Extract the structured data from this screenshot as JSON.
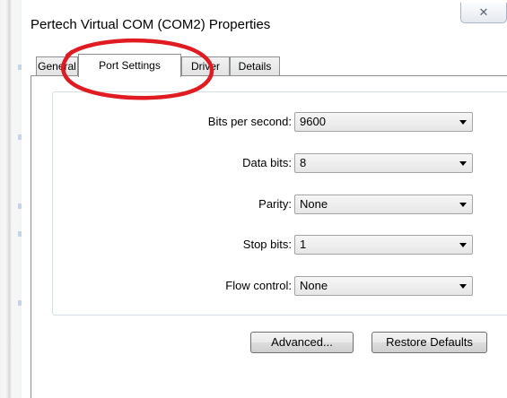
{
  "window": {
    "title": "Pertech Virtual COM (COM2) Properties",
    "close_glyph": "✕"
  },
  "tabs": [
    {
      "label": "General",
      "active": false
    },
    {
      "label": "Port Settings",
      "active": true
    },
    {
      "label": "Driver",
      "active": false
    },
    {
      "label": "Details",
      "active": false
    }
  ],
  "settings": [
    {
      "label": "Bits per second:",
      "value": "9600"
    },
    {
      "label": "Data bits:",
      "value": "8"
    },
    {
      "label": "Parity:",
      "value": "None"
    },
    {
      "label": "Stop bits:",
      "value": "1"
    },
    {
      "label": "Flow control:",
      "value": "None"
    }
  ],
  "buttons": {
    "advanced": "Advanced...",
    "restore_defaults": "Restore Defaults"
  },
  "annotation": {
    "color": "#e01b22",
    "shape": "ellipse",
    "target": "Port Settings tab"
  },
  "icons": {
    "close": "close-icon",
    "dropdown": "chevron-down-icon"
  }
}
